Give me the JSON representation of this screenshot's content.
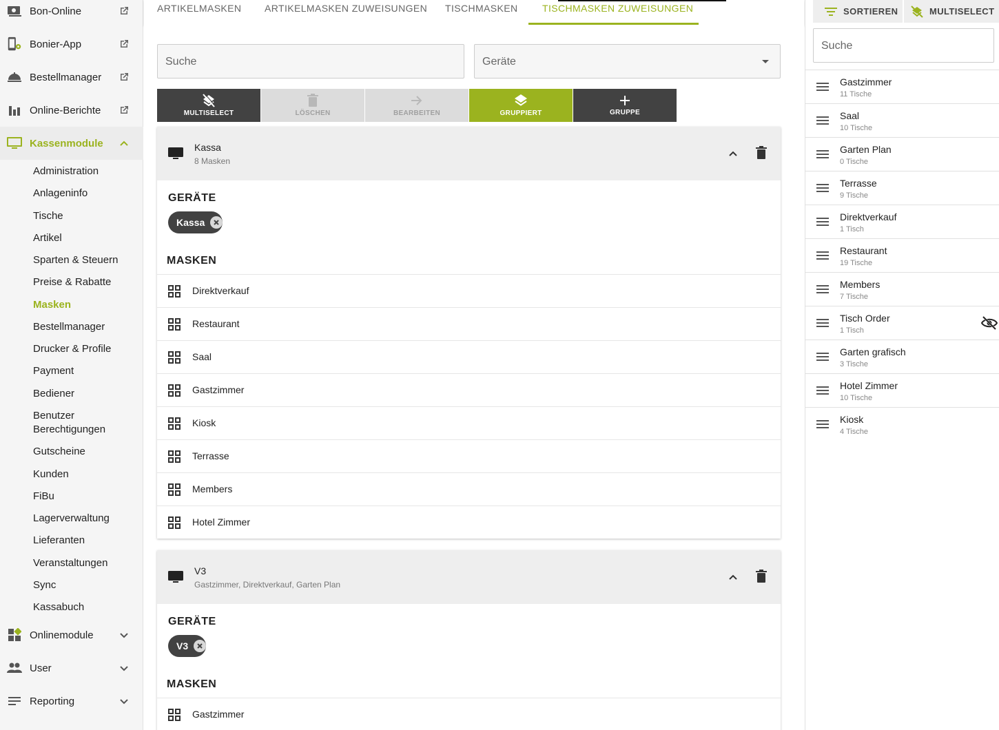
{
  "sidebar": {
    "top_items": [
      {
        "label": "Bon-Online",
        "icon": "cash-icon"
      },
      {
        "label": "Bonier-App",
        "icon": "tablet-settings-icon"
      },
      {
        "label": "Bestellmanager",
        "icon": "cloche-icon"
      },
      {
        "label": "Online-Berichte",
        "icon": "bar-chart-icon"
      }
    ],
    "kassenmodule": {
      "label": "Kassenmodule",
      "icon": "monitor-icon"
    },
    "sub_items": [
      "Administration",
      "Anlageninfo",
      "Tische",
      "Artikel",
      "Sparten & Steuern",
      "Preise & Rabatte",
      "Masken",
      "Bestellmanager",
      "Drucker & Profile",
      "Payment",
      "Bediener",
      "Benutzer\nBerechtigungen",
      "Gutscheine",
      "Kunden",
      "FiBu",
      "Lagerverwaltung",
      "Lieferanten",
      "Veranstaltungen",
      "Sync",
      "Kassabuch"
    ],
    "active_sub": "Masken",
    "bottom_items": [
      {
        "label": "Onlinemodule",
        "icon": "dashboard-icon"
      },
      {
        "label": "User",
        "icon": "people-icon"
      },
      {
        "label": "Reporting",
        "icon": "lines-icon"
      }
    ]
  },
  "tabs": [
    "ARTIKELMASKEN",
    "ARTIKELMASKEN ZUWEISUNGEN",
    "TISCHMASKEN",
    "TISCHMASKEN ZUWEISUNGEN"
  ],
  "active_tab": "TISCHMASKEN ZUWEISUNGEN",
  "filters": {
    "search_placeholder": "Suche",
    "devices_placeholder": "Geräte"
  },
  "toolbar": {
    "multiselect": "MULTISELECT",
    "delete": "LÖSCHEN",
    "edit": "BEARBEITEN",
    "grouped": "GRUPPIERT",
    "group": "GRUPPE"
  },
  "groups": [
    {
      "title": "Kassa",
      "subtitle": "8 Masken",
      "devices_heading": "GERÄTE",
      "device_chip": "Kassa",
      "masks_heading": "MASKEN",
      "masks": [
        "Direktverkauf",
        "Restaurant",
        "Saal",
        "Gastzimmer",
        "Kiosk",
        "Terrasse",
        "Members",
        "Hotel Zimmer"
      ]
    },
    {
      "title": "V3",
      "subtitle": "Gastzimmer, Direktverkauf, Garten Plan",
      "devices_heading": "GERÄTE",
      "device_chip": "V3",
      "masks_heading": "MASKEN",
      "masks": [
        "Gastzimmer"
      ]
    }
  ],
  "right_panel": {
    "sort_label": "SORTIEREN",
    "multiselect_label": "MULTISELECT",
    "search_placeholder": "Suche",
    "items": [
      {
        "name": "Gastzimmer",
        "count": "11 Tische"
      },
      {
        "name": "Saal",
        "count": "10 Tische"
      },
      {
        "name": "Garten Plan",
        "count": "0 Tische"
      },
      {
        "name": "Terrasse",
        "count": "9 Tische"
      },
      {
        "name": "Direktverkauf",
        "count": "1 Tisch"
      },
      {
        "name": "Restaurant",
        "count": "19 Tische"
      },
      {
        "name": "Members",
        "count": "7 Tische"
      },
      {
        "name": "Tisch Order",
        "count": "1 Tisch",
        "hidden": true
      },
      {
        "name": "Garten grafisch",
        "count": "3 Tische"
      },
      {
        "name": "Hotel Zimmer",
        "count": "10 Tische"
      },
      {
        "name": "Kiosk",
        "count": "4 Tische"
      }
    ]
  },
  "colors": {
    "accent": "#9bb31f",
    "dark": "#424242"
  }
}
